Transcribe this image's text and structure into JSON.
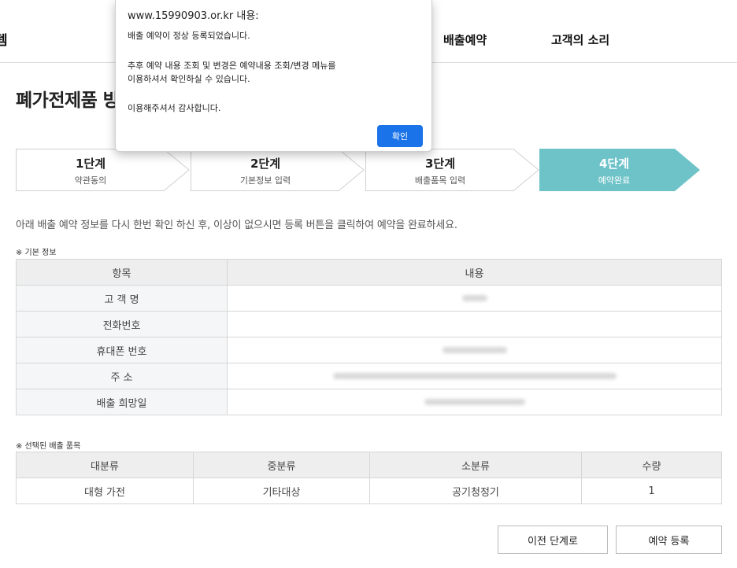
{
  "header": {
    "logo_fragment": "템",
    "nav": [
      {
        "label": "배출예약"
      },
      {
        "label": "고객의 소리"
      }
    ]
  },
  "page_title": "폐가전제품 방",
  "steps": [
    {
      "num": "1단계",
      "desc": "약관동의"
    },
    {
      "num": "2단계",
      "desc": "기본정보 입력"
    },
    {
      "num": "3단계",
      "desc": "배출품목 입력"
    },
    {
      "num": "4단계",
      "desc": "예약완료"
    }
  ],
  "active_color": "#6ec3c8",
  "notice": "아래 배출 예약 정보를 다시 한번 확인 하신 후, 이상이 없으시면 등록 버튼을 클릭하여 예약을 완료하세요.",
  "basic_info": {
    "label": "※ 기본 정보",
    "headers": [
      "항목",
      "내용"
    ],
    "rows": [
      {
        "label": "고 객 명"
      },
      {
        "label": "전화번호"
      },
      {
        "label": "휴대폰 번호"
      },
      {
        "label": "주 소"
      },
      {
        "label": "배출 희망일"
      }
    ]
  },
  "items": {
    "label": "※ 선택된 배출 품목",
    "headers": [
      "대분류",
      "중분류",
      "소분류",
      "수량"
    ],
    "rows": [
      [
        "대형 가전",
        "기타대상",
        "공기청정기",
        "1"
      ]
    ]
  },
  "buttons": {
    "prev": "이전 단계로",
    "submit": "예약 등록"
  },
  "dialog": {
    "origin": "www.15990903.or.kr 내용:",
    "line1": "배출 예약이 정상 등록되었습니다.",
    "line2": "추후 예약 내용 조회 및 변경은 예약내용 조회/변경 메뉴를",
    "line3": "이용하셔서 확인하실 수 있습니다.",
    "line4": "이용해주셔서 감사합니다.",
    "ok": "확인",
    "ok_color": "#1a73e8"
  }
}
